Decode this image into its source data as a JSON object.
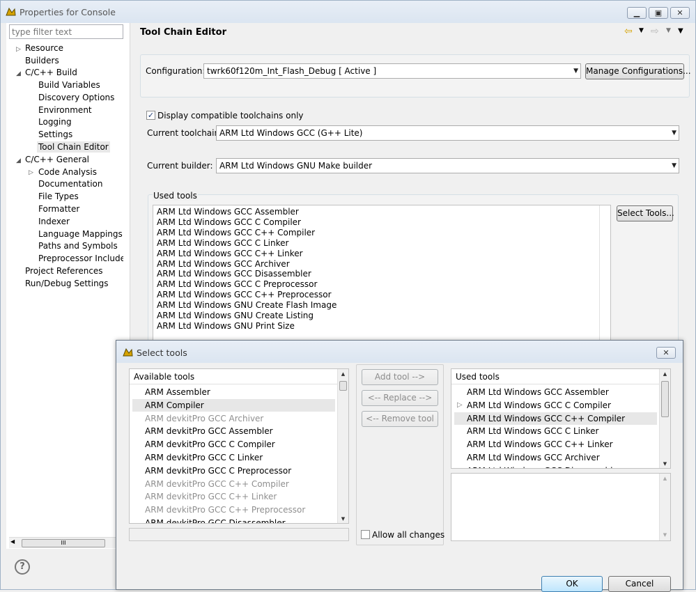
{
  "window": {
    "title": "Properties for Console",
    "minimize": "▭",
    "maximize": "▢",
    "close": "✕"
  },
  "sidebar": {
    "filter_placeholder": "type filter text",
    "items": [
      {
        "label": "Resource"
      },
      {
        "label": "Builders"
      },
      {
        "label": "C/C++ Build"
      },
      {
        "label": "Build Variables"
      },
      {
        "label": "Discovery Options"
      },
      {
        "label": "Environment"
      },
      {
        "label": "Logging"
      },
      {
        "label": "Settings"
      },
      {
        "label": "Tool Chain Editor"
      },
      {
        "label": "C/C++ General"
      },
      {
        "label": "Code Analysis"
      },
      {
        "label": "Documentation"
      },
      {
        "label": "File Types"
      },
      {
        "label": "Formatter"
      },
      {
        "label": "Indexer"
      },
      {
        "label": "Language Mappings"
      },
      {
        "label": "Paths and Symbols"
      },
      {
        "label": "Preprocessor Include Pa"
      },
      {
        "label": "Project References"
      },
      {
        "label": "Run/Debug Settings"
      }
    ],
    "hscroll_grip": "III"
  },
  "main": {
    "heading": "Tool Chain Editor",
    "configuration_label": "Configuration:",
    "configuration_value": "twrk60f120m_Int_Flash_Debug  [ Active ]",
    "manage_button": "Manage Configurations...",
    "display_compatible_label": "Display compatible toolchains only",
    "current_toolchain_label": "Current toolchain:",
    "current_toolchain_value": "ARM Ltd Windows GCC (G++ Lite)",
    "current_builder_label": "Current builder:",
    "current_builder_value": "ARM Ltd Windows GNU Make builder",
    "used_tools_label": "Used tools",
    "select_tools_button": "Select Tools...",
    "used_tools": [
      "ARM Ltd Windows GCC Assembler",
      "ARM Ltd Windows GCC C Compiler",
      "ARM Ltd Windows GCC C++ Compiler",
      "ARM Ltd Windows GCC C Linker",
      "ARM Ltd Windows GCC C++ Linker",
      "ARM Ltd Windows GCC Archiver",
      "ARM Ltd Windows GCC Disassembler",
      "ARM Ltd Windows GCC C Preprocessor",
      "ARM Ltd Windows GCC C++ Preprocessor",
      "ARM Ltd Windows GNU Create Flash Image",
      "ARM Ltd Windows GNU Create Listing",
      "ARM Ltd Windows GNU Print Size"
    ]
  },
  "help": {
    "icon": "?"
  },
  "dialog": {
    "title": "Select tools",
    "close": "✕",
    "available_header": "Available tools",
    "available_tools": [
      {
        "label": "ARM Assembler",
        "enabled": true
      },
      {
        "label": "ARM Compiler",
        "enabled": true,
        "selected": true
      },
      {
        "label": "ARM devkitPro GCC Archiver",
        "enabled": false
      },
      {
        "label": "ARM devkitPro GCC Assembler",
        "enabled": true
      },
      {
        "label": "ARM devkitPro GCC C Compiler",
        "enabled": true
      },
      {
        "label": "ARM devkitPro GCC C Linker",
        "enabled": true
      },
      {
        "label": "ARM devkitPro GCC C Preprocessor",
        "enabled": true
      },
      {
        "label": "ARM devkitPro GCC C++ Compiler",
        "enabled": false
      },
      {
        "label": "ARM devkitPro GCC C++ Linker",
        "enabled": false
      },
      {
        "label": "ARM devkitPro GCC C++ Preprocessor",
        "enabled": false
      },
      {
        "label": "ARM devkitPro GCC Disassembler",
        "enabled": true
      }
    ],
    "add_tool": "Add tool -->",
    "replace": "<-- Replace -->",
    "remove_tool": "<-- Remove tool",
    "allow_all_changes": "Allow all changes",
    "used_header": "Used tools",
    "used_tools": [
      {
        "label": "ARM Ltd Windows GCC Assembler"
      },
      {
        "label": "ARM Ltd Windows GCC C Compiler",
        "pointer": true
      },
      {
        "label": "ARM Ltd Windows GCC C++ Compiler",
        "selected": true
      },
      {
        "label": "ARM Ltd Windows GCC C Linker"
      },
      {
        "label": "ARM Ltd Windows GCC C++ Linker"
      },
      {
        "label": "ARM Ltd Windows GCC Archiver"
      },
      {
        "label": "ARM Ltd Windows GCC Disassembler"
      }
    ],
    "ok": "OK",
    "cancel": "Cancel"
  }
}
